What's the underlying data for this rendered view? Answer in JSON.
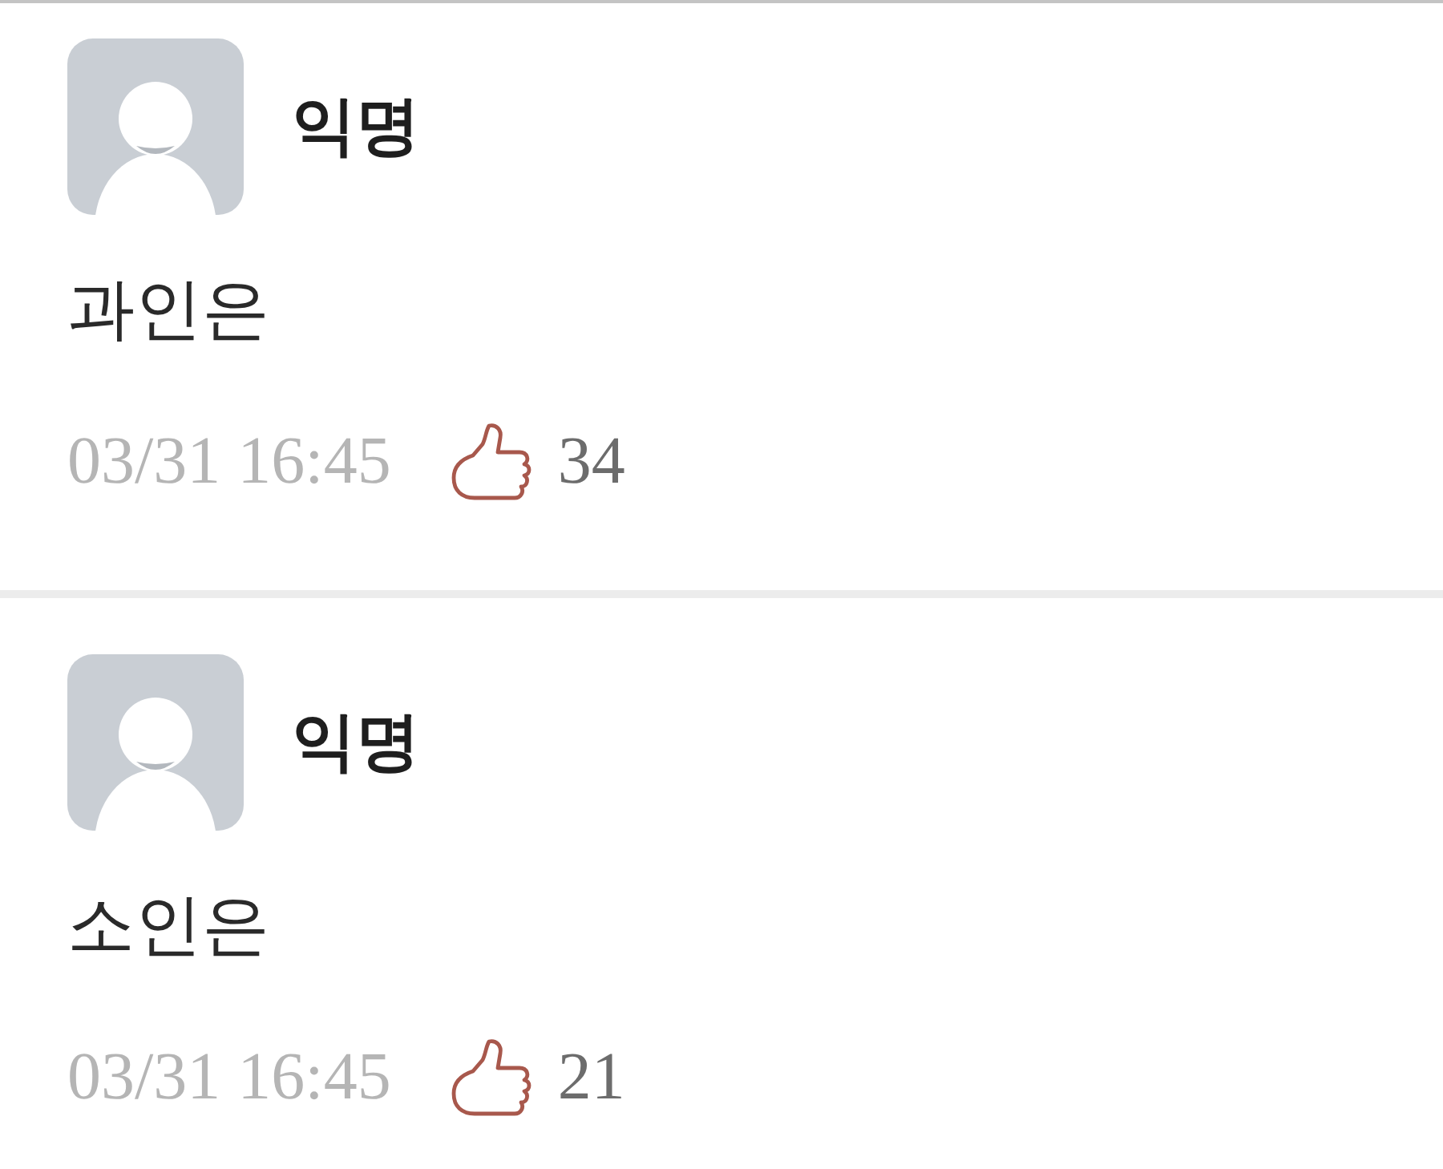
{
  "comments": [
    {
      "author": "익명",
      "text": "과인은",
      "time": "03/31 16:45",
      "likes": "34"
    },
    {
      "author": "익명",
      "text": "소인은",
      "time": "03/31 16:45",
      "likes": "21"
    }
  ]
}
